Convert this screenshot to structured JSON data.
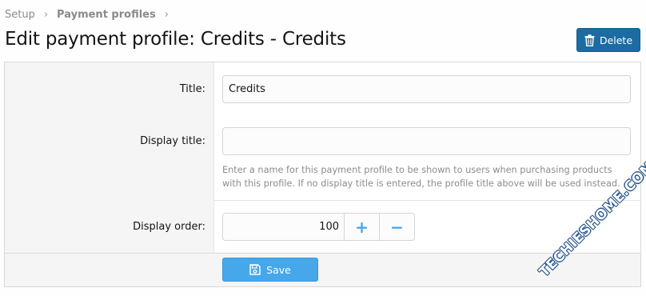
{
  "breadcrumb": {
    "items": [
      "Setup",
      "Payment profiles"
    ]
  },
  "page": {
    "title": "Edit payment profile: Credits - Credits",
    "delete_label": "Delete"
  },
  "form": {
    "title": {
      "label": "Title:",
      "value": "Credits"
    },
    "display_title": {
      "label": "Display title:",
      "value": "",
      "hint": "Enter a name for this payment profile to be shown to users when purchasing products with this profile. If no display title is entered, the profile title above will be used instead."
    },
    "display_order": {
      "label": "Display order:",
      "value": "100",
      "increment_label": "+",
      "decrement_label": "−"
    },
    "save_label": "Save"
  },
  "watermark": "TECHIESHOME.COM",
  "icons": {
    "separator": "chevron-right-icon",
    "delete": "trash-icon",
    "save": "floppy-disk-icon"
  },
  "colors": {
    "delete_button": "#1c6ca3",
    "save_button": "#47a7eb",
    "stepper_icons": "#47a7eb"
  }
}
